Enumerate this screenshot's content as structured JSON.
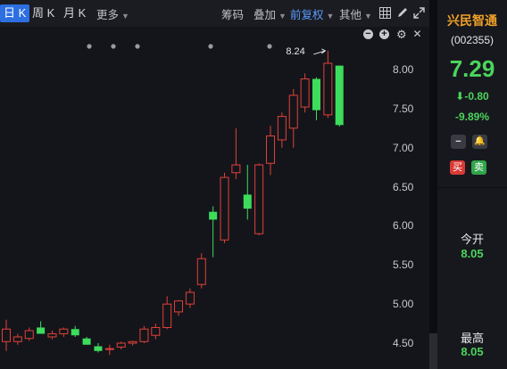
{
  "toolbar": {
    "period_day": "日 K",
    "period_week": "周 K",
    "period_month": "月 K",
    "more": "更多",
    "chips": "筹码",
    "overlay": "叠加",
    "adjust": "前复权",
    "other": "其他"
  },
  "stock": {
    "name": "兴民智通",
    "code": "(002355)",
    "price": "7.29",
    "change_arrow": "⬇",
    "change": "-0.80",
    "change_pct": "-9.89%",
    "buy_label": "买",
    "sell_label": "卖",
    "open_label": "今开",
    "open_value": "8.05",
    "high_label": "最高",
    "high_value": "8.05"
  },
  "colors": {
    "up": "#e0413a",
    "down": "#3ddc5c",
    "price_green": "#4bd45d",
    "name_orange": "#f0a028"
  },
  "chart_data": {
    "type": "candlestick",
    "y_ticks": [
      "8.00",
      "7.50",
      "7.00",
      "6.50",
      "6.00",
      "5.50",
      "5.00",
      "4.50"
    ],
    "ylim": [
      4.35,
      8.35
    ],
    "max_label": "8.24",
    "candles": [
      {
        "o": 4.52,
        "h": 4.8,
        "l": 4.4,
        "c": 4.68
      },
      {
        "o": 4.52,
        "h": 4.62,
        "l": 4.48,
        "c": 4.58
      },
      {
        "o": 4.56,
        "h": 4.7,
        "l": 4.53,
        "c": 4.66
      },
      {
        "o": 4.7,
        "h": 4.78,
        "l": 4.62,
        "c": 4.62
      },
      {
        "o": 4.58,
        "h": 4.66,
        "l": 4.55,
        "c": 4.62
      },
      {
        "o": 4.62,
        "h": 4.7,
        "l": 4.58,
        "c": 4.68
      },
      {
        "o": 4.68,
        "h": 4.72,
        "l": 4.58,
        "c": 4.6
      },
      {
        "o": 4.56,
        "h": 4.58,
        "l": 4.48,
        "c": 4.48
      },
      {
        "o": 4.46,
        "h": 4.5,
        "l": 4.38,
        "c": 4.4
      },
      {
        "o": 4.42,
        "h": 4.48,
        "l": 4.35,
        "c": 4.43
      },
      {
        "o": 4.45,
        "h": 4.52,
        "l": 4.42,
        "c": 4.5
      },
      {
        "o": 4.5,
        "h": 4.53,
        "l": 4.47,
        "c": 4.52
      },
      {
        "o": 4.52,
        "h": 4.72,
        "l": 4.5,
        "c": 4.68
      },
      {
        "o": 4.6,
        "h": 4.75,
        "l": 4.55,
        "c": 4.7
      },
      {
        "o": 4.7,
        "h": 5.1,
        "l": 4.68,
        "c": 5.0
      },
      {
        "o": 4.9,
        "h": 5.05,
        "l": 4.85,
        "c": 5.04
      },
      {
        "o": 5.0,
        "h": 5.2,
        "l": 4.95,
        "c": 5.15
      },
      {
        "o": 5.25,
        "h": 5.65,
        "l": 5.2,
        "c": 5.58
      },
      {
        "o": 6.18,
        "h": 6.25,
        "l": 5.6,
        "c": 6.08
      },
      {
        "o": 5.82,
        "h": 6.68,
        "l": 5.78,
        "c": 6.62
      },
      {
        "o": 6.68,
        "h": 7.25,
        "l": 6.6,
        "c": 6.78
      },
      {
        "o": 6.4,
        "h": 6.78,
        "l": 6.08,
        "c": 6.22
      },
      {
        "o": 5.9,
        "h": 6.8,
        "l": 5.88,
        "c": 6.78
      },
      {
        "o": 6.8,
        "h": 7.28,
        "l": 6.65,
        "c": 7.15
      },
      {
        "o": 7.1,
        "h": 7.45,
        "l": 7.0,
        "c": 7.4
      },
      {
        "o": 7.25,
        "h": 7.75,
        "l": 7.0,
        "c": 7.67
      },
      {
        "o": 7.52,
        "h": 7.95,
        "l": 7.45,
        "c": 7.88
      },
      {
        "o": 7.88,
        "h": 7.9,
        "l": 7.35,
        "c": 7.48
      },
      {
        "o": 7.42,
        "h": 8.24,
        "l": 7.38,
        "c": 8.08
      },
      {
        "o": 8.05,
        "h": 8.05,
        "l": 7.27,
        "c": 7.29
      }
    ]
  }
}
